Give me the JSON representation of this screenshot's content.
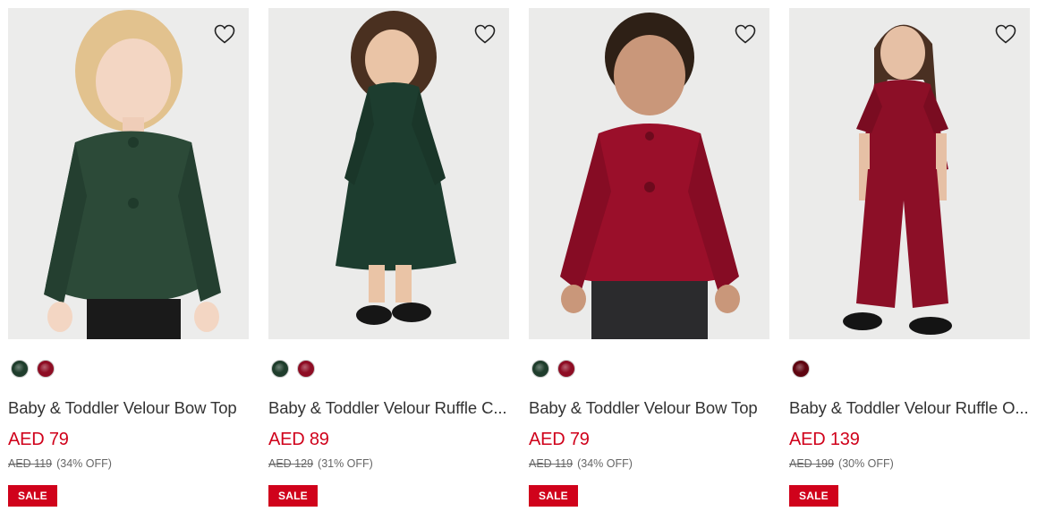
{
  "products": [
    {
      "name": "Baby & Toddler Velour Bow Top",
      "price": "AED 79",
      "was": "AED 119",
      "discount": "(34% OFF)",
      "badge": "SALE",
      "image_alt": "Toddler wearing green velour bow top",
      "swatches": [
        {
          "color": "#1f3d2c",
          "name": "green"
        },
        {
          "color": "#8e0d24",
          "name": "red"
        }
      ]
    },
    {
      "name": "Baby & Toddler Velour Ruffle C...",
      "price": "AED 89",
      "was": "AED 129",
      "discount": "(31% OFF)",
      "badge": "SALE",
      "image_alt": "Toddler wearing green velour ruffle dress",
      "swatches": [
        {
          "color": "#1f3d2c",
          "name": "green"
        },
        {
          "color": "#8e0d24",
          "name": "red"
        }
      ]
    },
    {
      "name": "Baby & Toddler Velour Bow Top",
      "price": "AED 79",
      "was": "AED 119",
      "discount": "(34% OFF)",
      "badge": "SALE",
      "image_alt": "Toddler wearing red velour bow top",
      "swatches": [
        {
          "color": "#1f3d2c",
          "name": "green"
        },
        {
          "color": "#8e0d24",
          "name": "red"
        }
      ]
    },
    {
      "name": "Baby & Toddler Velour Ruffle O...",
      "price": "AED 139",
      "was": "AED 199",
      "discount": "(30% OFF)",
      "badge": "SALE",
      "image_alt": "Toddler wearing red velour ruffle outfit",
      "swatches": [
        {
          "color": "#5e0410",
          "name": "burgundy"
        }
      ]
    }
  ],
  "colors": {
    "sale_red": "#d0021b",
    "image_bg": "#ebebea"
  }
}
